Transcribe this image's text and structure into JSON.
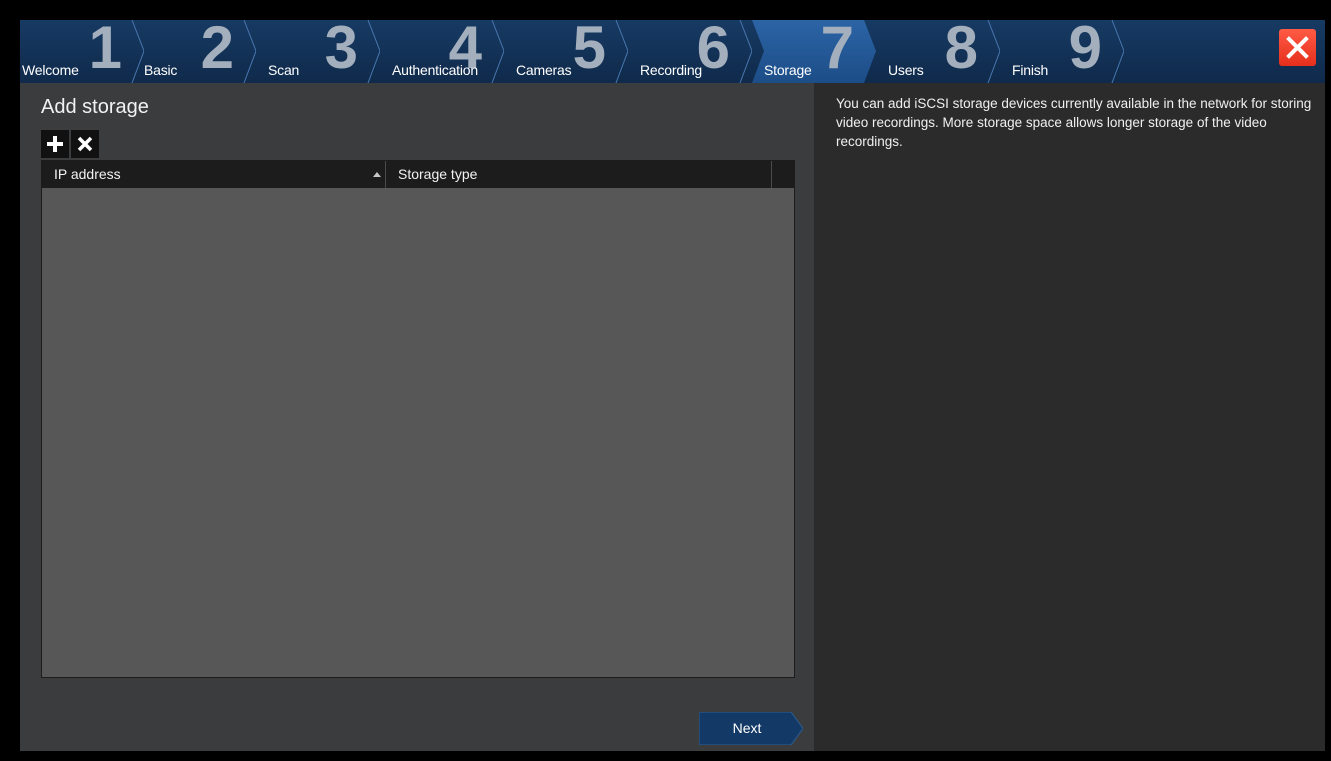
{
  "steps": [
    {
      "number": "1",
      "label": "Welcome",
      "active": false
    },
    {
      "number": "2",
      "label": "Basic",
      "active": false
    },
    {
      "number": "3",
      "label": "Scan",
      "active": false
    },
    {
      "number": "4",
      "label": "Authentication",
      "active": false
    },
    {
      "number": "5",
      "label": "Cameras",
      "active": false
    },
    {
      "number": "6",
      "label": "Recording",
      "active": false
    },
    {
      "number": "7",
      "label": "Storage",
      "active": true
    },
    {
      "number": "8",
      "label": "Users",
      "active": false
    },
    {
      "number": "9",
      "label": "Finish",
      "active": false
    }
  ],
  "close_icon": "close-icon",
  "main": {
    "title": "Add storage",
    "toolbar": {
      "add_icon": "plus-icon",
      "remove_icon": "x-icon"
    },
    "table": {
      "columns": [
        "IP address",
        "Storage type"
      ],
      "sort_column": "IP address",
      "sort_direction": "ascending",
      "rows": []
    },
    "next_label": "Next"
  },
  "help_text": "You can add iSCSI storage devices currently available in the network for storing video recordings. More storage space allows longer storage of the video recordings.",
  "colors": {
    "accent": "#1c4d87",
    "active_step": "#2c64a6",
    "close": "#e52f1c"
  }
}
